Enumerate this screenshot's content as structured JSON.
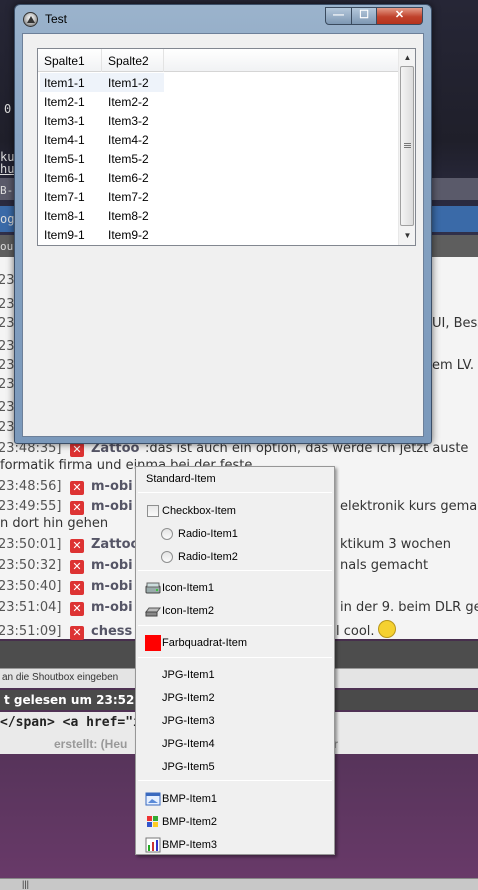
{
  "window": {
    "title": "Test",
    "buttons": {
      "minimize": "—",
      "maximize": "☐",
      "close": "✕"
    }
  },
  "listview": {
    "columns": [
      "Spalte1",
      "Spalte2"
    ],
    "rows": [
      [
        "Item1-1",
        "Item1-2"
      ],
      [
        "Item2-1",
        "Item2-2"
      ],
      [
        "Item3-1",
        "Item3-2"
      ],
      [
        "Item4-1",
        "Item4-2"
      ],
      [
        "Item5-1",
        "Item5-2"
      ],
      [
        "Item6-1",
        "Item6-2"
      ],
      [
        "Item7-1",
        "Item7-2"
      ],
      [
        "Item8-1",
        "Item8-2"
      ],
      [
        "Item9-1",
        "Item9-2"
      ]
    ],
    "selected_row": 0
  },
  "menu": {
    "standard": "Standard-Item",
    "checkbox": "Checkbox-Item",
    "radio1": "Radio-Item1",
    "radio2": "Radio-Item2",
    "icon1": "Icon-Item1",
    "icon2": "Icon-Item2",
    "color": "Farbquadrat-Item",
    "color_swatch": "#ff0000",
    "jpg": [
      "JPG-Item1",
      "JPG-Item2",
      "JPG-Item3",
      "JPG-Item4",
      "JPG-Item5"
    ],
    "bmp": [
      "BMP-Item1",
      "BMP-Item2",
      "BMP-Item3"
    ]
  },
  "background": {
    "top_fragments": [
      "0:",
      "ku",
      "hu",
      "B-C",
      "ogg",
      "out"
    ],
    "shouts": [
      {
        "time": "23",
        "right": ""
      },
      {
        "time": "23",
        "right": ""
      },
      {
        "time": "23",
        "right": "UI, Bess"
      },
      {
        "time": "23",
        "right": ""
      },
      {
        "time": "23",
        "right": "em LV."
      },
      {
        "time": "23",
        "right": ""
      },
      {
        "time": "23",
        "right": ""
      },
      {
        "time": "23",
        "right": ""
      }
    ],
    "line_zattoo_1": {
      "time": "23:48:35]",
      "user": "Zattoo",
      "msg": ":das ist auch ein option, das werde ich jetzt auste"
    },
    "line_zattoo_1b": "formatik firma und einma bei der feste",
    "line_mobi_1": {
      "time": "23:48:56]",
      "user": "m-obi",
      "right": ""
    },
    "line_mobi_2": {
      "time": "23:49:55]",
      "user": "m-obi",
      "right": "elektronik kurs gemacl"
    },
    "line_mobi_2b": "n dort hin gehen",
    "line_zattoo_2": {
      "time": "23:50:01]",
      "user": "Zattoo",
      "right": "ktikum 3 wochen"
    },
    "line_mobi_3": {
      "time": "23:50:32]",
      "user": "m-obi",
      "right": "nals gemacht"
    },
    "line_mobi_4": {
      "time": "23:50:40]",
      "user": "m-obi",
      "right": ""
    },
    "line_mobi_5": {
      "time": "23:51:04]",
      "user": "m-obi",
      "right": "in der 9. beim DLR ge"
    },
    "line_chess": {
      "time": "23:51:09]",
      "user": "chess",
      "right": "l cool."
    },
    "input_placeholder": "an die Shoutbox eingeben",
    "status": "t gelesen um 23:52:3",
    "code": "</span> <a href=\"inc",
    "meta_left": "erstellt: (Heu",
    "meta_right": "ser",
    "taskbar_glyph": "|||"
  }
}
